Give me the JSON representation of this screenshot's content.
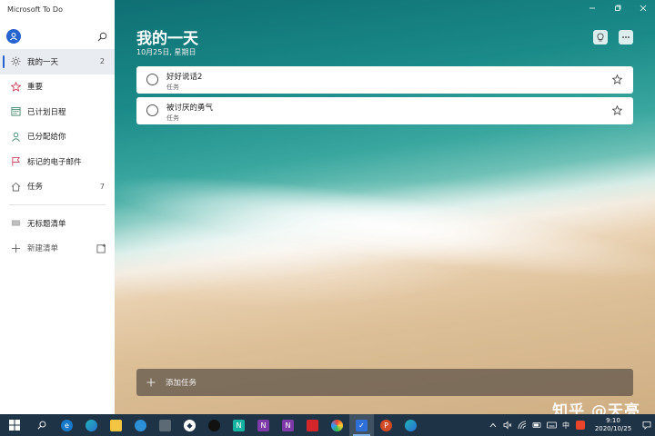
{
  "window": {
    "app_title": "Microsoft To Do"
  },
  "sidebar": {
    "items": [
      {
        "label": "我的一天",
        "count": "2",
        "icon": "sun-icon"
      },
      {
        "label": "重要",
        "count": "",
        "icon": "star-icon"
      },
      {
        "label": "已计划日程",
        "count": "",
        "icon": "calendar-icon"
      },
      {
        "label": "已分配给你",
        "count": "",
        "icon": "person-icon"
      },
      {
        "label": "标记的电子邮件",
        "count": "",
        "icon": "flag-icon"
      },
      {
        "label": "任务",
        "count": "7",
        "icon": "home-icon"
      }
    ],
    "custom_list": {
      "label": "无标题清单",
      "icon": "list-icon"
    },
    "new_list": {
      "label": "新建清单",
      "icon": "plus-icon"
    }
  },
  "main": {
    "title": "我的一天",
    "date": "10月25日, 星期日",
    "tasks": [
      {
        "title": "好好说话2",
        "subtitle": "任务"
      },
      {
        "title": "被讨厌的勇气",
        "subtitle": "任务"
      }
    ],
    "add_task_label": "添加任务"
  },
  "watermark": "知乎 @天亮",
  "taskbar": {
    "apps": [
      "file-explorer-icon",
      "edge-icon",
      "edge-icon-2",
      "folder-icon",
      "app-refresh-icon",
      "camera-icon",
      "water-drop-icon",
      "qq-icon",
      "n-app-icon",
      "onenote-icon",
      "onenote-icon-2",
      "red-app-icon",
      "colorful-app-icon",
      "todo-icon",
      "powerpoint-icon",
      "edge-icon-3"
    ],
    "ime": "中",
    "time": "9:10",
    "date": "2020/10/25"
  },
  "colors": {
    "accent": "#2564cf",
    "taskbar": "#1f3346",
    "sidebar_active": "#e9ecf1"
  }
}
